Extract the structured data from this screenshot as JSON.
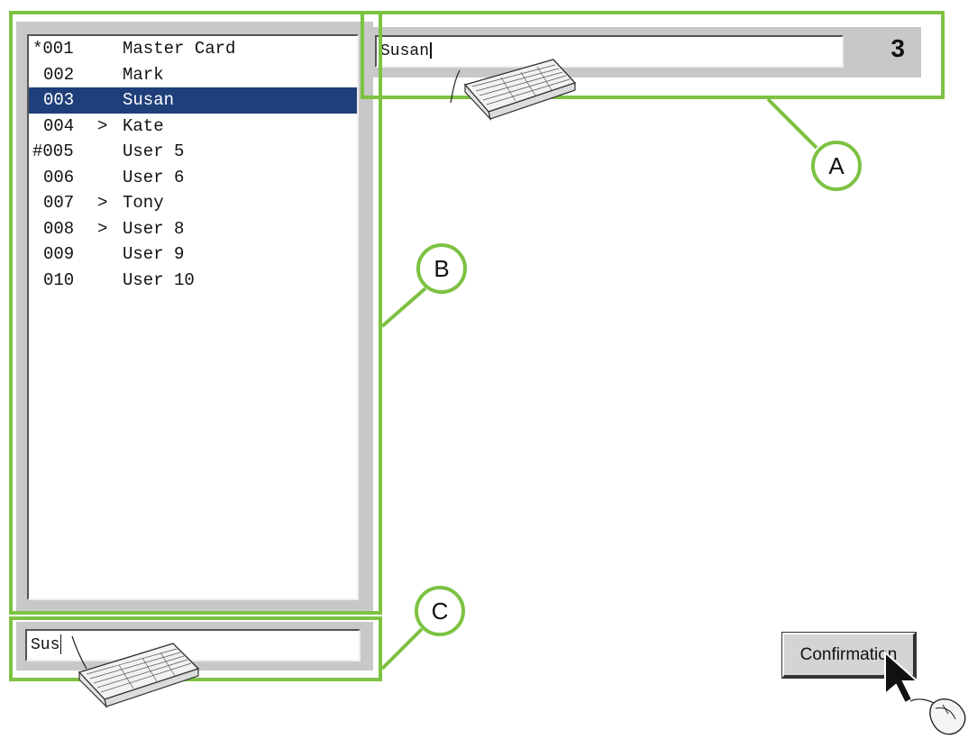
{
  "user_list": {
    "items": [
      {
        "prefix": "*",
        "id": "001",
        "marker": "",
        "name": "Master Card",
        "selected": false
      },
      {
        "prefix": "",
        "id": "002",
        "marker": "",
        "name": "Mark",
        "selected": false
      },
      {
        "prefix": "",
        "id": "003",
        "marker": "",
        "name": "Susan",
        "selected": true
      },
      {
        "prefix": "",
        "id": "004",
        "marker": ">",
        "name": "Kate",
        "selected": false
      },
      {
        "prefix": "#",
        "id": "005",
        "marker": "",
        "name": "User 5",
        "selected": false
      },
      {
        "prefix": "",
        "id": "006",
        "marker": "",
        "name": "User 6",
        "selected": false
      },
      {
        "prefix": "",
        "id": "007",
        "marker": ">",
        "name": "Tony",
        "selected": false
      },
      {
        "prefix": "",
        "id": "008",
        "marker": ">",
        "name": "User 8",
        "selected": false
      },
      {
        "prefix": "",
        "id": "009",
        "marker": "",
        "name": "User 9",
        "selected": false
      },
      {
        "prefix": "",
        "id": "010",
        "marker": "",
        "name": "User 10",
        "selected": false
      }
    ]
  },
  "name_field": {
    "value": "Susan"
  },
  "user_number": "3",
  "search_field": {
    "value": "Sus"
  },
  "confirm_button": {
    "label": "Confirmation"
  },
  "callouts": {
    "a": "A",
    "b": "B",
    "c": "C"
  },
  "colors": {
    "highlight": "#7dc242",
    "selection": "#1f3f7a",
    "panel": "#c8c8c8"
  },
  "icons": [
    "keyboard-icon",
    "keyboard-icon",
    "mouse-icon",
    "mouse-pointer-icon"
  ]
}
